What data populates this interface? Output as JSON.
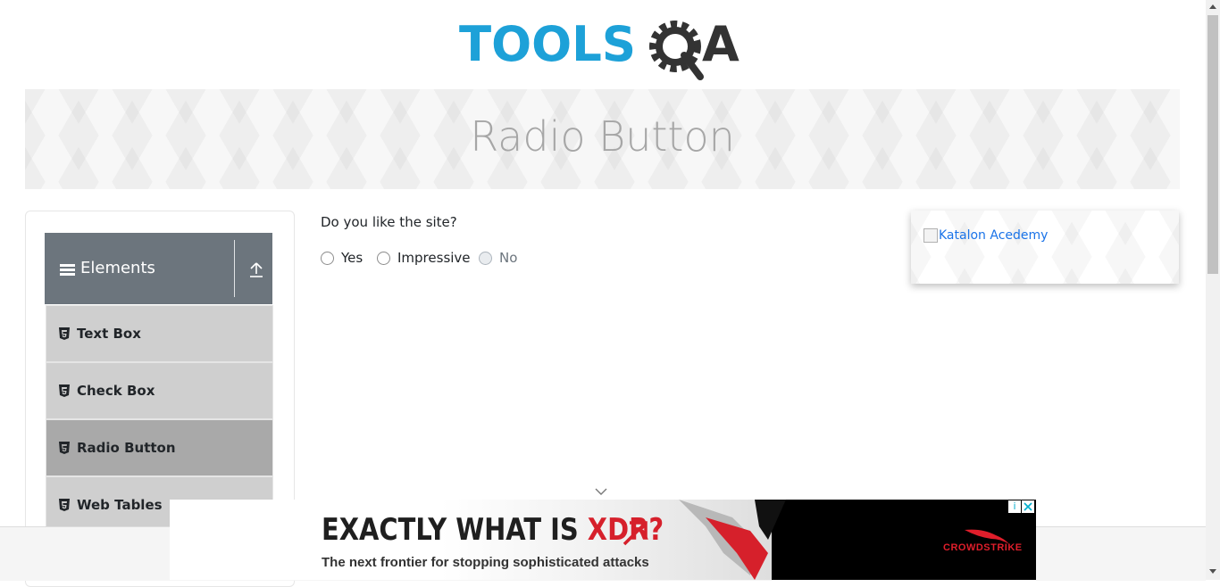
{
  "header": {
    "logo": {
      "text_left": "TOOLS",
      "text_right": "QA",
      "colors": {
        "blue": "#1da1d8",
        "dark": "#333333"
      }
    }
  },
  "banner": {
    "title": "Radio Button"
  },
  "sidebar": {
    "group": {
      "label": "Elements",
      "icon": "hamburger-icon",
      "toggle_icon": "upload-icon",
      "color": "#6c757d"
    },
    "items": [
      {
        "label": "Text Box",
        "icon": "html5-icon",
        "active": false
      },
      {
        "label": "Check Box",
        "icon": "html5-icon",
        "active": false
      },
      {
        "label": "Radio Button",
        "icon": "html5-icon",
        "active": true
      },
      {
        "label": "Web Tables",
        "icon": "html5-icon",
        "active": false
      }
    ]
  },
  "main": {
    "question": "Do you like the site?",
    "options": [
      {
        "label": "Yes",
        "selected": false,
        "disabled": false
      },
      {
        "label": "Impressive",
        "selected": false,
        "disabled": false
      },
      {
        "label": "No",
        "selected": false,
        "disabled": true
      }
    ]
  },
  "right_ad": {
    "broken_image_alt": "Katalon Acedemy",
    "link_color": "#1a73e8"
  },
  "footer_ad": {
    "headline_prefix": "EXACTLY WHAT IS ",
    "headline_highlight": "XDR?",
    "subtext": "The next frontier for stopping sophisticated attacks",
    "brand": "CROWDSTRIKE",
    "info_icon": "info-icon",
    "close_icon": "close-icon",
    "colors": {
      "red": "#d6202b",
      "black": "#000000"
    }
  },
  "icons": {
    "scroll_down": "chevron-down-icon"
  }
}
